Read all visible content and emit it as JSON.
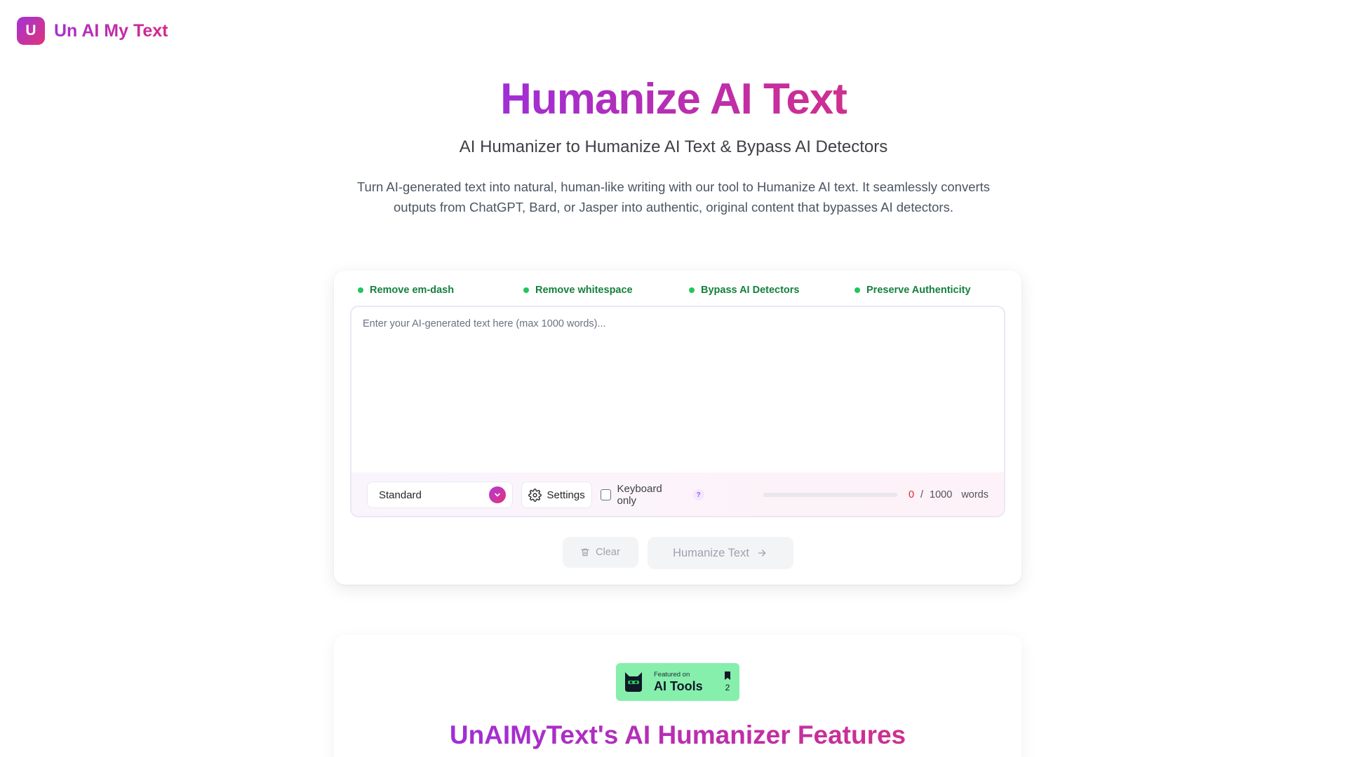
{
  "brand": {
    "logo_letter": "U",
    "name": "Un AI My Text"
  },
  "hero": {
    "title": "Humanize AI Text",
    "subtitle": "AI Humanizer to Humanize AI Text & Bypass AI Detectors",
    "description": "Turn AI-generated text into natural, human-like writing with our tool to Humanize AI text. It seamlessly converts outputs from ChatGPT, Bard, or Jasper into authentic, original content that bypasses AI detectors."
  },
  "features": [
    {
      "label": "Remove em-dash"
    },
    {
      "label": "Remove whitespace"
    },
    {
      "label": "Bypass AI Detectors"
    },
    {
      "label": "Preserve Authenticity"
    }
  ],
  "editor": {
    "placeholder": "Enter your AI-generated text here (max 1000 words)...",
    "value": ""
  },
  "toolbar": {
    "mode": "Standard",
    "settings_label": "Settings",
    "keyboard_only_label": "Keyboard only",
    "help_label": "?",
    "word_count": "0",
    "separator": "/",
    "word_limit": "1000",
    "words_label": "words",
    "progress": 0
  },
  "actions": {
    "clear_label": "Clear",
    "humanize_label": "Humanize Text"
  },
  "featured_badge": {
    "small_text": "Featured on",
    "big_text": "AI Tools",
    "count": "2"
  },
  "features_section": {
    "title": "UnAIMyText's AI Humanizer Features"
  },
  "colors": {
    "accent_purple": "#a333d6",
    "accent_pink": "#e0337a",
    "feature_green": "#15803d",
    "badge_green": "#86efac",
    "count_red": "#dc2626"
  }
}
